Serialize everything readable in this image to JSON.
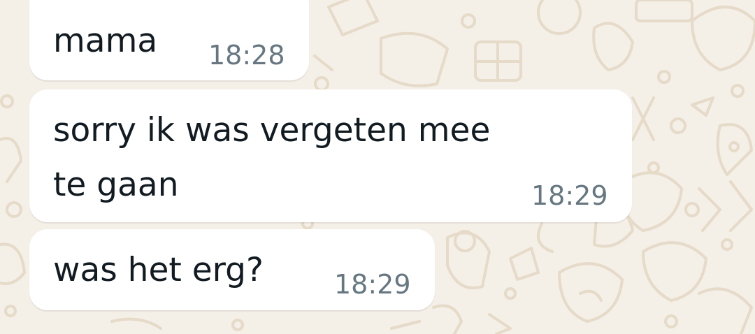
{
  "messages": [
    {
      "text": "mama",
      "time": "18:28"
    },
    {
      "line1": "sorry ik was vergeten mee",
      "line2": "te gaan",
      "time": "18:29"
    },
    {
      "text": "was het erg?",
      "time": "18:29"
    }
  ],
  "colors": {
    "wallpaper": "#f4efe7",
    "doodle": "#e6dac8",
    "bubble": "#ffffff",
    "text": "#111b21",
    "time": "#667781"
  }
}
